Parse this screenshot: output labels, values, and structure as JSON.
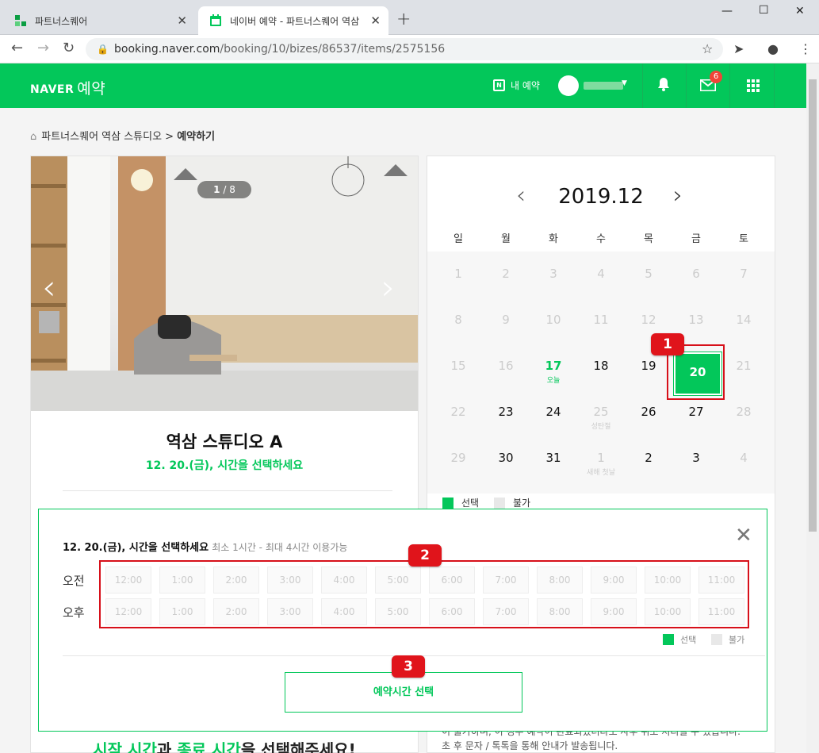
{
  "browser": {
    "tabs": [
      {
        "title": "파트너스퀘어",
        "active": false
      },
      {
        "title": "네이버 예약 - 파트너스퀘어 역삼",
        "active": true
      }
    ],
    "url_host": "booking.naver.com",
    "url_path": "/booking/10/bizes/86537/items/2575156",
    "new_tab_icon": "+",
    "close_icon": "✕"
  },
  "header": {
    "logo_text": "NAVER",
    "logo_suffix": "예약",
    "my_reservation": "내 예약",
    "mail_badge": "6"
  },
  "breadcrumb": {
    "parent": "파트너스퀘어 역삼 스튜디오 >",
    "current": "예약하기"
  },
  "gallery": {
    "current": "1",
    "total": "8"
  },
  "studio": {
    "title": "역삼 스튜디오 A",
    "subtitle": "12. 20.(금), 시간을 선택하세요",
    "promo_g1": "시작 시간",
    "promo_mid": "과 ",
    "promo_g2": "종료 시간",
    "promo_end": "을 선택해주세요!"
  },
  "calendar": {
    "month": "2019.12",
    "weekdays": [
      "일",
      "월",
      "화",
      "수",
      "목",
      "금",
      "토"
    ],
    "selected_day": "20",
    "weeks": [
      [
        {
          "d": "1",
          "s": "dis"
        },
        {
          "d": "2",
          "s": "dis"
        },
        {
          "d": "3",
          "s": "dis"
        },
        {
          "d": "4",
          "s": "dis"
        },
        {
          "d": "5",
          "s": "dis"
        },
        {
          "d": "6",
          "s": "dis"
        },
        {
          "d": "7",
          "s": "dis"
        }
      ],
      [
        {
          "d": "8",
          "s": "dis"
        },
        {
          "d": "9",
          "s": "dis"
        },
        {
          "d": "10",
          "s": "dis"
        },
        {
          "d": "11",
          "s": "dis"
        },
        {
          "d": "12",
          "s": "dis"
        },
        {
          "d": "13",
          "s": "dis"
        },
        {
          "d": "14",
          "s": "dis"
        }
      ],
      [
        {
          "d": "15",
          "s": "dis"
        },
        {
          "d": "16",
          "s": "dis"
        },
        {
          "d": "17",
          "s": "today",
          "sub": "오늘"
        },
        {
          "d": "18",
          "s": "on"
        },
        {
          "d": "19",
          "s": "on"
        },
        {
          "d": "20",
          "s": "sel"
        },
        {
          "d": "21",
          "s": "dis"
        }
      ],
      [
        {
          "d": "22",
          "s": "dis"
        },
        {
          "d": "23",
          "s": "on"
        },
        {
          "d": "24",
          "s": "on"
        },
        {
          "d": "25",
          "s": "dis",
          "sub": "성탄절"
        },
        {
          "d": "26",
          "s": "on"
        },
        {
          "d": "27",
          "s": "on"
        },
        {
          "d": "28",
          "s": "dis"
        }
      ],
      [
        {
          "d": "29",
          "s": "dis"
        },
        {
          "d": "30",
          "s": "on"
        },
        {
          "d": "31",
          "s": "on"
        },
        {
          "d": "1",
          "s": "dis",
          "sub": "새해 첫날"
        },
        {
          "d": "2",
          "s": "on"
        },
        {
          "d": "3",
          "s": "on"
        },
        {
          "d": "4",
          "s": "dis"
        }
      ]
    ],
    "legend_selected": "선택",
    "legend_unavailable": "불가",
    "bottom_text_1": "이 불가하며, 이 경우 예약이 완료되었더라도 사후 취소 처리될 수 있습니다.",
    "bottom_text_2": "초 후 문자 / 톡톡을 통해 안내가 발송됩니다."
  },
  "time_popup": {
    "title": "12. 20.(금), 시간을 선택하세요",
    "hint": "최소 1시간 - 최대 4시간 이용가능",
    "am_label": "오전",
    "pm_label": "오후",
    "slots": [
      "12:00",
      "1:00",
      "2:00",
      "3:00",
      "4:00",
      "5:00",
      "6:00",
      "7:00",
      "8:00",
      "9:00",
      "10:00",
      "11:00"
    ],
    "legend_selected": "선택",
    "legend_unavailable": "불가",
    "select_button": "예약시간 선택"
  },
  "annotations": [
    "1",
    "2",
    "3"
  ],
  "colors": {
    "brand": "#03c75a",
    "annotation_red": "#e0141b"
  }
}
